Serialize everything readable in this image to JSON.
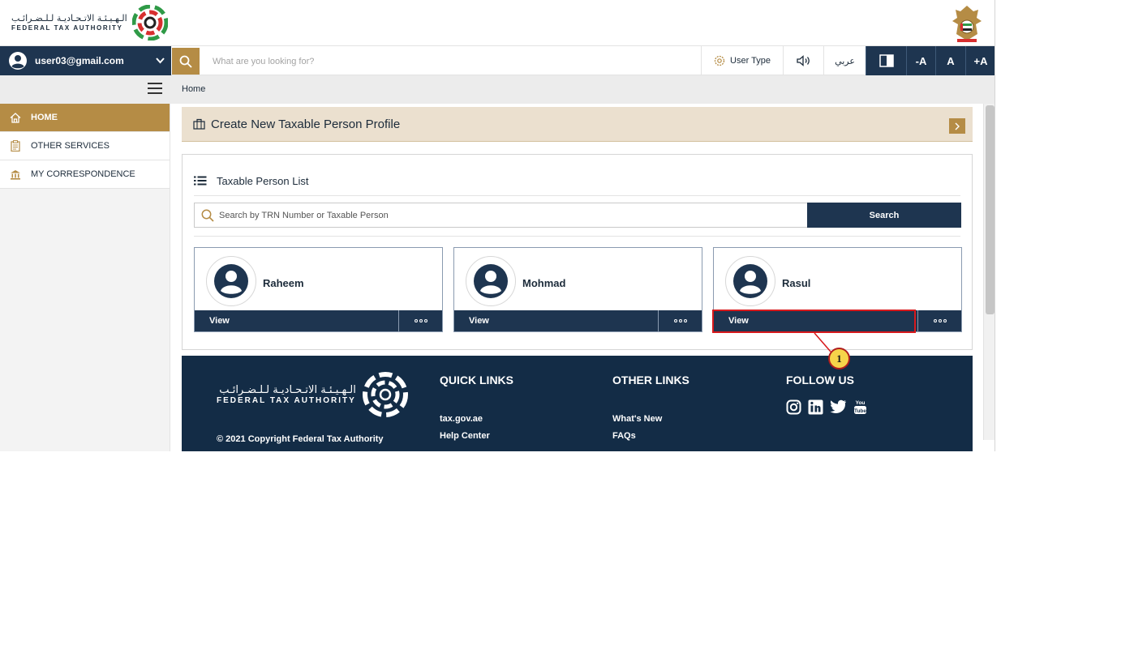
{
  "header": {
    "logo_ar": "الـهـيـئـة الاتـحـاديـة لـلـضـرائـب",
    "logo_en": "FEDERAL TAX AUTHORITY"
  },
  "navbar": {
    "user_email": "user03@gmail.com",
    "search_placeholder": "What are you looking for?",
    "user_type_label": "User Type",
    "language_label": "عربي",
    "font_decrease": "-A",
    "font_normal": "A",
    "font_increase": "+A"
  },
  "breadcrumb": {
    "current": "Home"
  },
  "sidebar": {
    "items": [
      {
        "label": "HOME",
        "icon": "home-icon",
        "active": true
      },
      {
        "label": "OTHER SERVICES",
        "icon": "clipboard-icon",
        "active": false
      },
      {
        "label": "MY CORRESPONDENCE",
        "icon": "bank-icon",
        "active": false
      }
    ]
  },
  "main": {
    "create_profile_label": "Create New Taxable Person Profile",
    "list_title": "Taxable Person List",
    "search_placeholder": "Search by TRN Number or Taxable Person",
    "search_button": "Search",
    "persons": [
      {
        "name": "Raheem",
        "view_label": "View"
      },
      {
        "name": "Mohmad",
        "view_label": "View"
      },
      {
        "name": "Rasul",
        "view_label": "View"
      }
    ],
    "callout_number": "1"
  },
  "footer": {
    "logo_ar": "الـهـيـئـة الاتـحـاديـة لـلـضـرائـب",
    "logo_en": "FEDERAL TAX AUTHORITY",
    "copyright": "© 2021 Copyright Federal Tax Authority",
    "quick_links_title": "QUICK LINKS",
    "quick_links": [
      "tax.gov.ae",
      "Help Center"
    ],
    "other_links_title": "OTHER LINKS",
    "other_links": [
      "What's New",
      "FAQs"
    ],
    "follow_title": "FOLLOW US",
    "social_icons": [
      "instagram-icon",
      "linkedin-icon",
      "twitter-icon",
      "youtube-icon"
    ]
  },
  "colors": {
    "navy": "#1e3550",
    "gold": "#b58c45",
    "footer_bg": "#132c46",
    "banner_bg": "#ebe0cf",
    "highlight": "#d7191c",
    "callout": "#f6d44a"
  }
}
